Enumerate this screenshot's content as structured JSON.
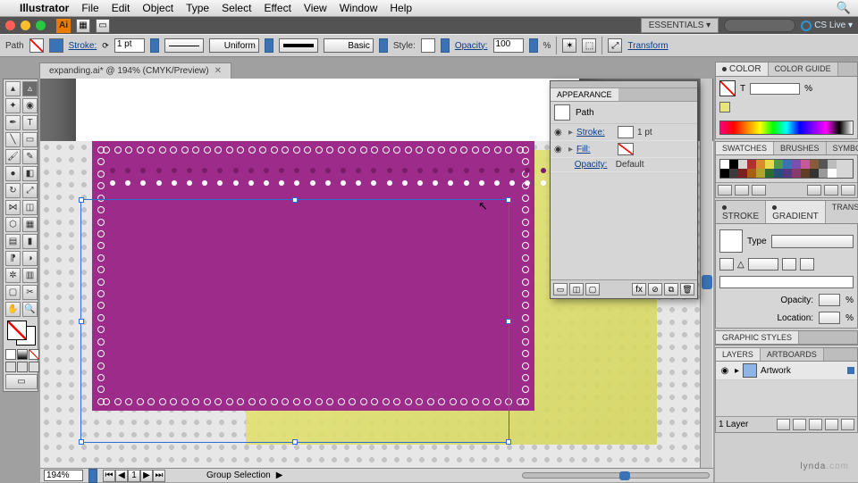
{
  "menubar": {
    "app": "Illustrator",
    "items": [
      "File",
      "Edit",
      "Object",
      "Type",
      "Select",
      "Effect",
      "View",
      "Window",
      "Help"
    ]
  },
  "titlebar": {
    "logo": "Ai",
    "workspace": "ESSENTIALS ▾",
    "cslive": "CS Live ▾"
  },
  "options": {
    "path_label": "Path",
    "stroke_label": "Stroke:",
    "stroke_pt": "1 pt",
    "profile": "Uniform",
    "brush": "Basic",
    "style_label": "Style:",
    "opacity_label": "Opacity:",
    "opacity_val": "100",
    "opacity_pct": "%",
    "transform": "Transform"
  },
  "doc_tab": {
    "title": "expanding.ai* @ 194% (CMYK/Preview)"
  },
  "status": {
    "zoom": "194%",
    "art_idx": "1",
    "mode": "Group Selection"
  },
  "appearance": {
    "panel": "APPEARANCE",
    "object": "Path",
    "rows": [
      {
        "name": "Stroke:",
        "val": "1 pt",
        "sw": "box"
      },
      {
        "name": "Fill:",
        "val": "",
        "sw": "diag"
      },
      {
        "name": "Opacity:",
        "val": "Default",
        "sw": "none",
        "plain": true
      }
    ],
    "foot_fx": "fx"
  },
  "panels": {
    "color": {
      "tabs": [
        "COLOR",
        "COLOR GUIDE"
      ],
      "t_label": "T",
      "pct": "%"
    },
    "swatches": {
      "tabs": [
        "SWATCHES",
        "BRUSHES",
        "SYMBOLS"
      ]
    },
    "stroke": {
      "tabs": [
        "STROKE",
        "GRADIENT",
        "TRANSPARE"
      ],
      "type_label": "Type",
      "opacity": "Opacity:",
      "location": "Location:",
      "pct": "%"
    },
    "gs": {
      "tabs": [
        "GRAPHIC STYLES"
      ]
    },
    "layers": {
      "tabs": [
        "LAYERS",
        "ARTBOARDS"
      ],
      "layer_name": "Artwork",
      "count": "1 Layer"
    }
  },
  "swatch_colors": [
    "#fff",
    "#000",
    "#d6d6d6",
    "#b03030",
    "#d88b2a",
    "#e9da4b",
    "#4b9b4b",
    "#3a72b5",
    "#7a4fae",
    "#c65a98",
    "#8a5a3a",
    "#555",
    "#bbb",
    "#000",
    "#3b3b3b",
    "#7e2020",
    "#a85e13",
    "#b0a32c",
    "#2f6a2f",
    "#274f7e",
    "#543a7e",
    "#8a3a6a",
    "#5e3e24",
    "#333",
    "#999",
    "#fff"
  ],
  "watermark": {
    "text1": "lynda",
    "text2": ".com"
  }
}
